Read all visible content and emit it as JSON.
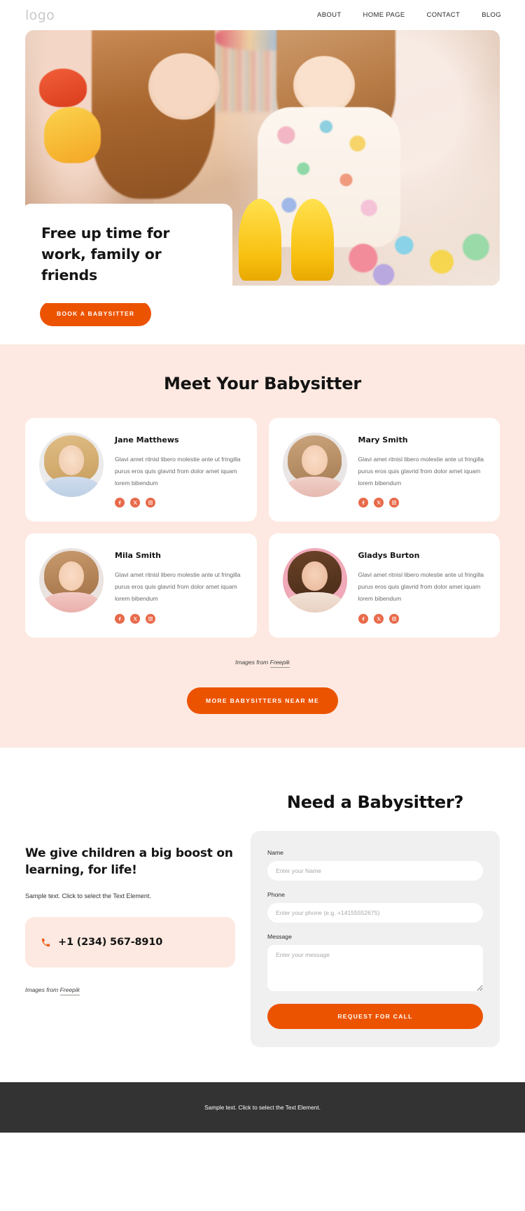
{
  "header": {
    "logo": "logo",
    "nav": [
      {
        "label": "ABOUT"
      },
      {
        "label": "HOME PAGE"
      },
      {
        "label": "CONTACT"
      },
      {
        "label": "BLOG"
      }
    ]
  },
  "hero": {
    "title": "Free up time  for work, family or friends",
    "cta": "BOOK A BABYSITTER"
  },
  "meet": {
    "title": "Meet Your Babysitter",
    "credit_prefix": "Images from ",
    "credit_link": "Freepik",
    "cta": "MORE BABYSITTERS NEAR ME",
    "cards": [
      {
        "name": "Jane Matthews",
        "text": "Glavi amet ritnisl libero molestie ante ut fringilla purus eros quis glavrid from dolor amet iquam lorem bibendum",
        "socials": [
          "facebook-icon",
          "x-twitter-icon",
          "instagram-icon"
        ]
      },
      {
        "name": "Mary Smith",
        "text": "Glavi amet ritnisl libero molestie ante ut fringilla purus eros quis glavrid from dolor amet iquam lorem bibendum",
        "socials": [
          "facebook-icon",
          "x-twitter-icon",
          "instagram-icon"
        ]
      },
      {
        "name": "Mila Smith",
        "text": "Glavi amet ritnisl libero molestie ante ut fringilla purus eros quis glavrid from dolor amet iquam lorem bibendum",
        "socials": [
          "facebook-icon",
          "x-twitter-icon",
          "instagram-icon"
        ]
      },
      {
        "name": "Gladys Burton",
        "text": "Glavi amet ritnisl libero molestie ante ut fringilla purus eros quis glavrid from dolor amet iquam lorem bibendum",
        "socials": [
          "facebook-icon",
          "x-twitter-icon",
          "instagram-icon"
        ]
      }
    ]
  },
  "contact": {
    "left_title": "We give children a big boost on learning, for life!",
    "left_sub": "Sample text. Click to select the Text Element.",
    "phone": "+1 (234) 567-8910",
    "credit_prefix": "Images from ",
    "credit_link": "Freepik",
    "form_title": "Need a Babysitter?",
    "fields": {
      "name_label": "Name",
      "name_placeholder": "Enter your Name",
      "phone_label": "Phone",
      "phone_placeholder": "Enter your phone (e.g. +14155552675)",
      "message_label": "Message",
      "message_placeholder": "Enter your message"
    },
    "submit": "REQUEST FOR CALL"
  },
  "footer": {
    "text": "Sample text. Click to select the Text Element."
  },
  "colors": {
    "accent": "#ec5300",
    "social": "#e86a4a",
    "section_bg": "#fde9e1",
    "form_bg": "#f0f0f0",
    "footer_bg": "#333333"
  }
}
